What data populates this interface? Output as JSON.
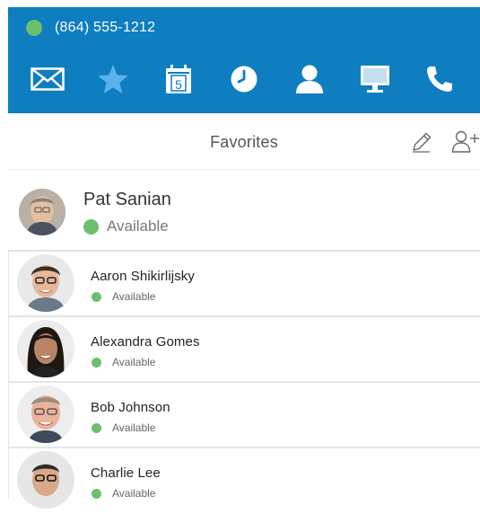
{
  "header": {
    "phone_number": "(864) 555-1212",
    "status_color": "#6bc06b",
    "background_color": "#0e7ec0",
    "nav": [
      {
        "icon": "envelope-icon",
        "name": "messages"
      },
      {
        "icon": "star-icon",
        "name": "favorites"
      },
      {
        "icon": "calendar-icon",
        "name": "calendar",
        "badge": "5"
      },
      {
        "icon": "clock-icon",
        "name": "history"
      },
      {
        "icon": "person-icon",
        "name": "contacts"
      },
      {
        "icon": "monitor-icon",
        "name": "meetings"
      },
      {
        "icon": "phone-icon",
        "name": "dialer"
      }
    ]
  },
  "favorites_bar": {
    "title": "Favorites",
    "edit_icon": "pencil-icon",
    "add_icon": "add-user-icon"
  },
  "me": {
    "name": "Pat Sanian",
    "status": "Available"
  },
  "contacts": [
    {
      "name": "Aaron Shikirlijsky",
      "status": "Available"
    },
    {
      "name": "Alexandra Gomes",
      "status": "Available"
    },
    {
      "name": "Bob Johnson",
      "status": "Available"
    },
    {
      "name": "Charlie Lee",
      "status": "Available"
    }
  ]
}
